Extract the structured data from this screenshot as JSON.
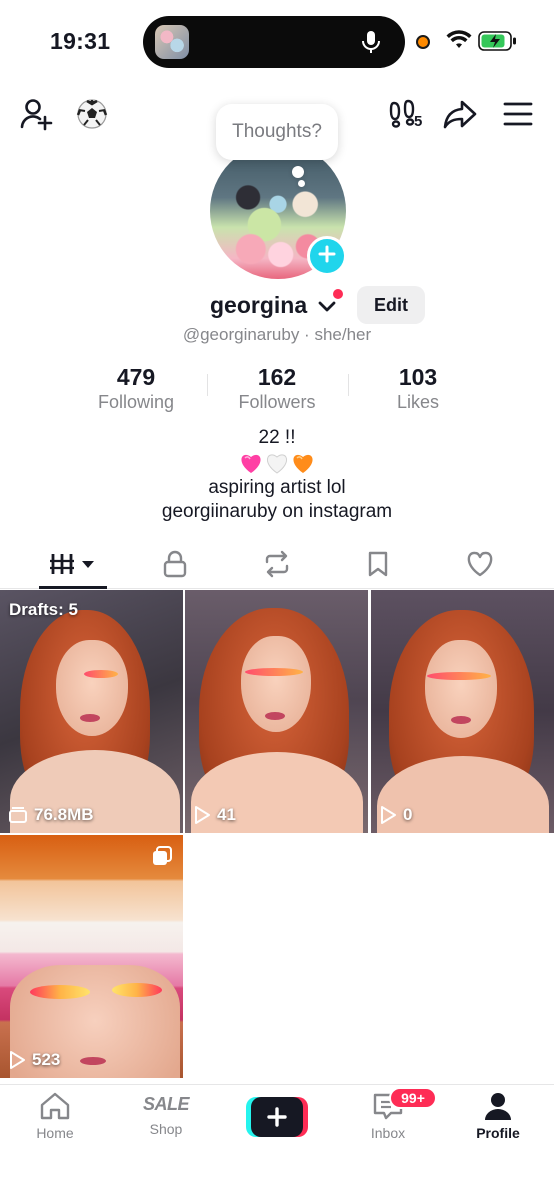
{
  "status_bar": {
    "time": "19:31"
  },
  "topbar": {
    "icons": [
      "add-friend-icon",
      "soccer-ball-icon",
      "footprint-icon",
      "share-icon",
      "menu-icon"
    ],
    "sound_badge_count": "5",
    "thoughts_placeholder": "Thoughts?"
  },
  "profile": {
    "display_name": "georgina",
    "edit_label": "Edit",
    "handle_line": "@georginaruby · she/her",
    "stats": {
      "following": {
        "value": "479",
        "label": "Following"
      },
      "followers": {
        "value": "162",
        "label": "Followers"
      },
      "likes": {
        "value": "103",
        "label": "Likes"
      }
    },
    "bio": {
      "line1": "22 !!",
      "line2_emoji": [
        "pink-heart",
        "white-heart",
        "orange-heart"
      ],
      "line3": "aspiring artist lol",
      "line4": "georgiinaruby on instagram"
    }
  },
  "tabs": {
    "items": [
      "videos-tab",
      "private-tab",
      "reposts-tab",
      "favorites-tab",
      "liked-tab"
    ],
    "active": "videos-tab"
  },
  "grid": {
    "tiles": [
      {
        "overlay": "Drafts: 5",
        "meta": "76.8MB",
        "meta_icon": "drafts-folder-icon"
      },
      {
        "meta": "41",
        "meta_icon": "play-icon"
      },
      {
        "meta": "0",
        "meta_icon": "play-icon"
      },
      {
        "meta": "523",
        "meta_icon": "play-icon",
        "multi": true
      }
    ]
  },
  "bottom_nav": {
    "home": "Home",
    "shop": "Shop",
    "shop_badge_text": "SALE",
    "inbox": "Inbox",
    "inbox_badge": "99+",
    "profile": "Profile",
    "active": "profile"
  },
  "colors": {
    "accent_red": "#fe2c55",
    "accent_cyan": "#25f4ee",
    "add_blue": "#20d5ec",
    "text": "#161823",
    "muted": "#86878b"
  }
}
